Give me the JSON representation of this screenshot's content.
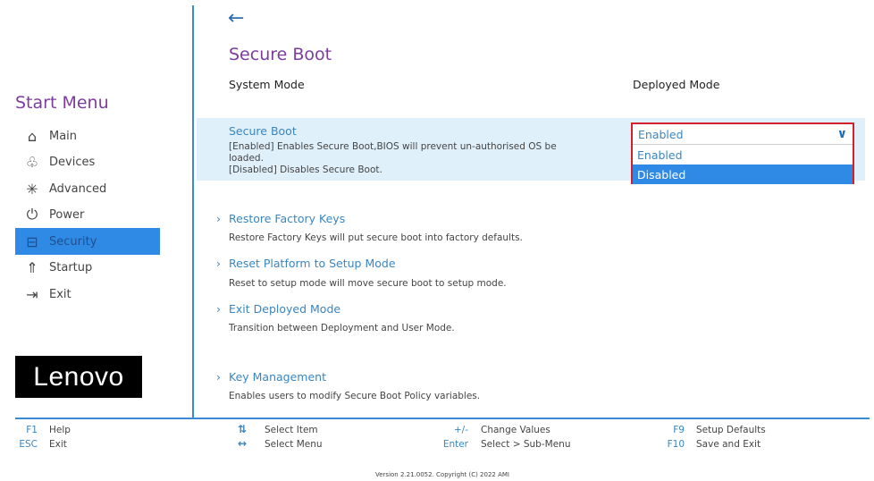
{
  "sidebar": {
    "title": "Start Menu",
    "items": [
      {
        "label": "Main",
        "icon": "home-icon"
      },
      {
        "label": "Devices",
        "icon": "devices-icon"
      },
      {
        "label": "Advanced",
        "icon": "advanced-icon"
      },
      {
        "label": "Power",
        "icon": "power-icon"
      },
      {
        "label": "Security",
        "icon": "lock-icon",
        "selected": true
      },
      {
        "label": "Startup",
        "icon": "startup-icon"
      },
      {
        "label": "Exit",
        "icon": "exit-icon"
      }
    ],
    "logo": "Lenovo"
  },
  "page": {
    "title": "Secure Boot",
    "system_mode_label": "System Mode",
    "system_mode_value": "Deployed Mode"
  },
  "secure_boot": {
    "label": "Secure Boot",
    "desc1": "[Enabled] Enables Secure Boot,BIOS will prevent un-authorised OS be",
    "desc2": "loaded.",
    "desc3": "[Disabled] Disables Secure Boot.",
    "value": "Enabled",
    "options": [
      "Enabled",
      "Disabled"
    ],
    "highlighted": "Disabled"
  },
  "links": [
    {
      "label": "Restore Factory Keys",
      "desc": "Restore Factory Keys will put secure boot into factory defaults."
    },
    {
      "label": "Reset Platform to Setup Mode",
      "desc": "Reset to setup mode will move secure boot to setup mode."
    },
    {
      "label": "Exit Deployed Mode",
      "desc": "Transition between Deployment and User Mode."
    },
    {
      "label": "Key Management",
      "desc": "Enables users to modify Secure Boot Policy variables."
    }
  ],
  "footer": {
    "f1": {
      "key": "F1",
      "label": "Help"
    },
    "esc": {
      "key": "ESC",
      "label": "Exit"
    },
    "updown": {
      "key": "⇅",
      "label": "Select Item"
    },
    "leftright": {
      "key": "↔",
      "label": "Select Menu"
    },
    "plusminus": {
      "key": "+/-",
      "label": "Change Values"
    },
    "enter": {
      "key": "Enter",
      "label": "Select > Sub-Menu"
    },
    "f9": {
      "key": "F9",
      "label": "Setup Defaults"
    },
    "f10": {
      "key": "F10",
      "label": "Save and Exit"
    },
    "version": "Version 2.21.0052. Copyright (C) 2022 AMI"
  },
  "colors": {
    "accent": "#2f8ae6",
    "title": "#7c3d9e",
    "link": "#3a86c0",
    "highlight_border": "#d4202c"
  }
}
